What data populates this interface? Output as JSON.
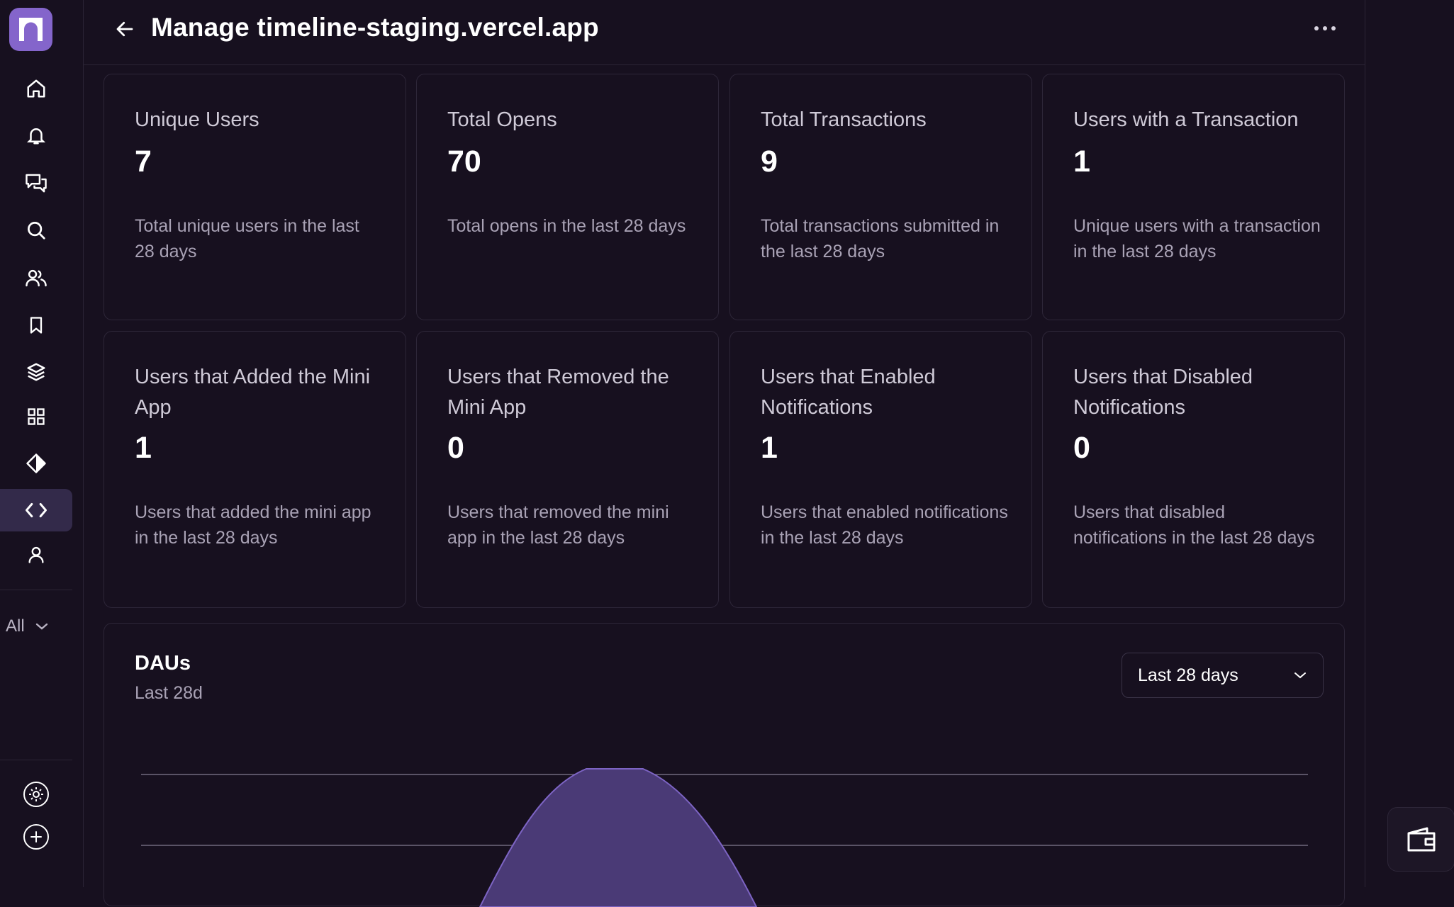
{
  "header": {
    "title": "Manage timeline-staging.vercel.app"
  },
  "sidebar": {
    "items": [
      {
        "name": "home-icon"
      },
      {
        "name": "bell-icon"
      },
      {
        "name": "chat-icon"
      },
      {
        "name": "search-icon"
      },
      {
        "name": "users-icon"
      },
      {
        "name": "bookmark-icon"
      },
      {
        "name": "layers-icon"
      },
      {
        "name": "grid-icon"
      },
      {
        "name": "diamond-icon"
      },
      {
        "name": "code-icon",
        "active": true
      },
      {
        "name": "user-icon"
      }
    ],
    "filter_label": "All",
    "bottom": [
      {
        "name": "settings-icon"
      },
      {
        "name": "add-icon"
      }
    ]
  },
  "stats": [
    {
      "title": "Unique Users",
      "value": "7",
      "desc": "Total unique users in the last 28 days"
    },
    {
      "title": "Total Opens",
      "value": "70",
      "desc": "Total opens in the last 28 days"
    },
    {
      "title": "Total Transactions",
      "value": "9",
      "desc": "Total transactions submitted in the last 28 days"
    },
    {
      "title": "Users with a Transaction",
      "value": "1",
      "desc": "Unique users with a transaction in the last 28 days"
    },
    {
      "title": "Users that Added the Mini App",
      "value": "1",
      "desc": "Users that added the mini app in the last 28 days"
    },
    {
      "title": "Users that Removed the Mini App",
      "value": "0",
      "desc": "Users that removed the mini app in the last 28 days"
    },
    {
      "title": "Users that Enabled Notifications",
      "value": "1",
      "desc": "Users that enabled notifications in the last 28 days"
    },
    {
      "title": "Users that Disabled Notifications",
      "value": "0",
      "desc": "Users that disabled notifications in the last 28 days"
    }
  ],
  "dau": {
    "title": "DAUs",
    "subtitle": "Last 28d",
    "range_selected": "Last 28 days"
  },
  "colors": {
    "accent": "#8465cb",
    "area": "#4a3a76"
  }
}
